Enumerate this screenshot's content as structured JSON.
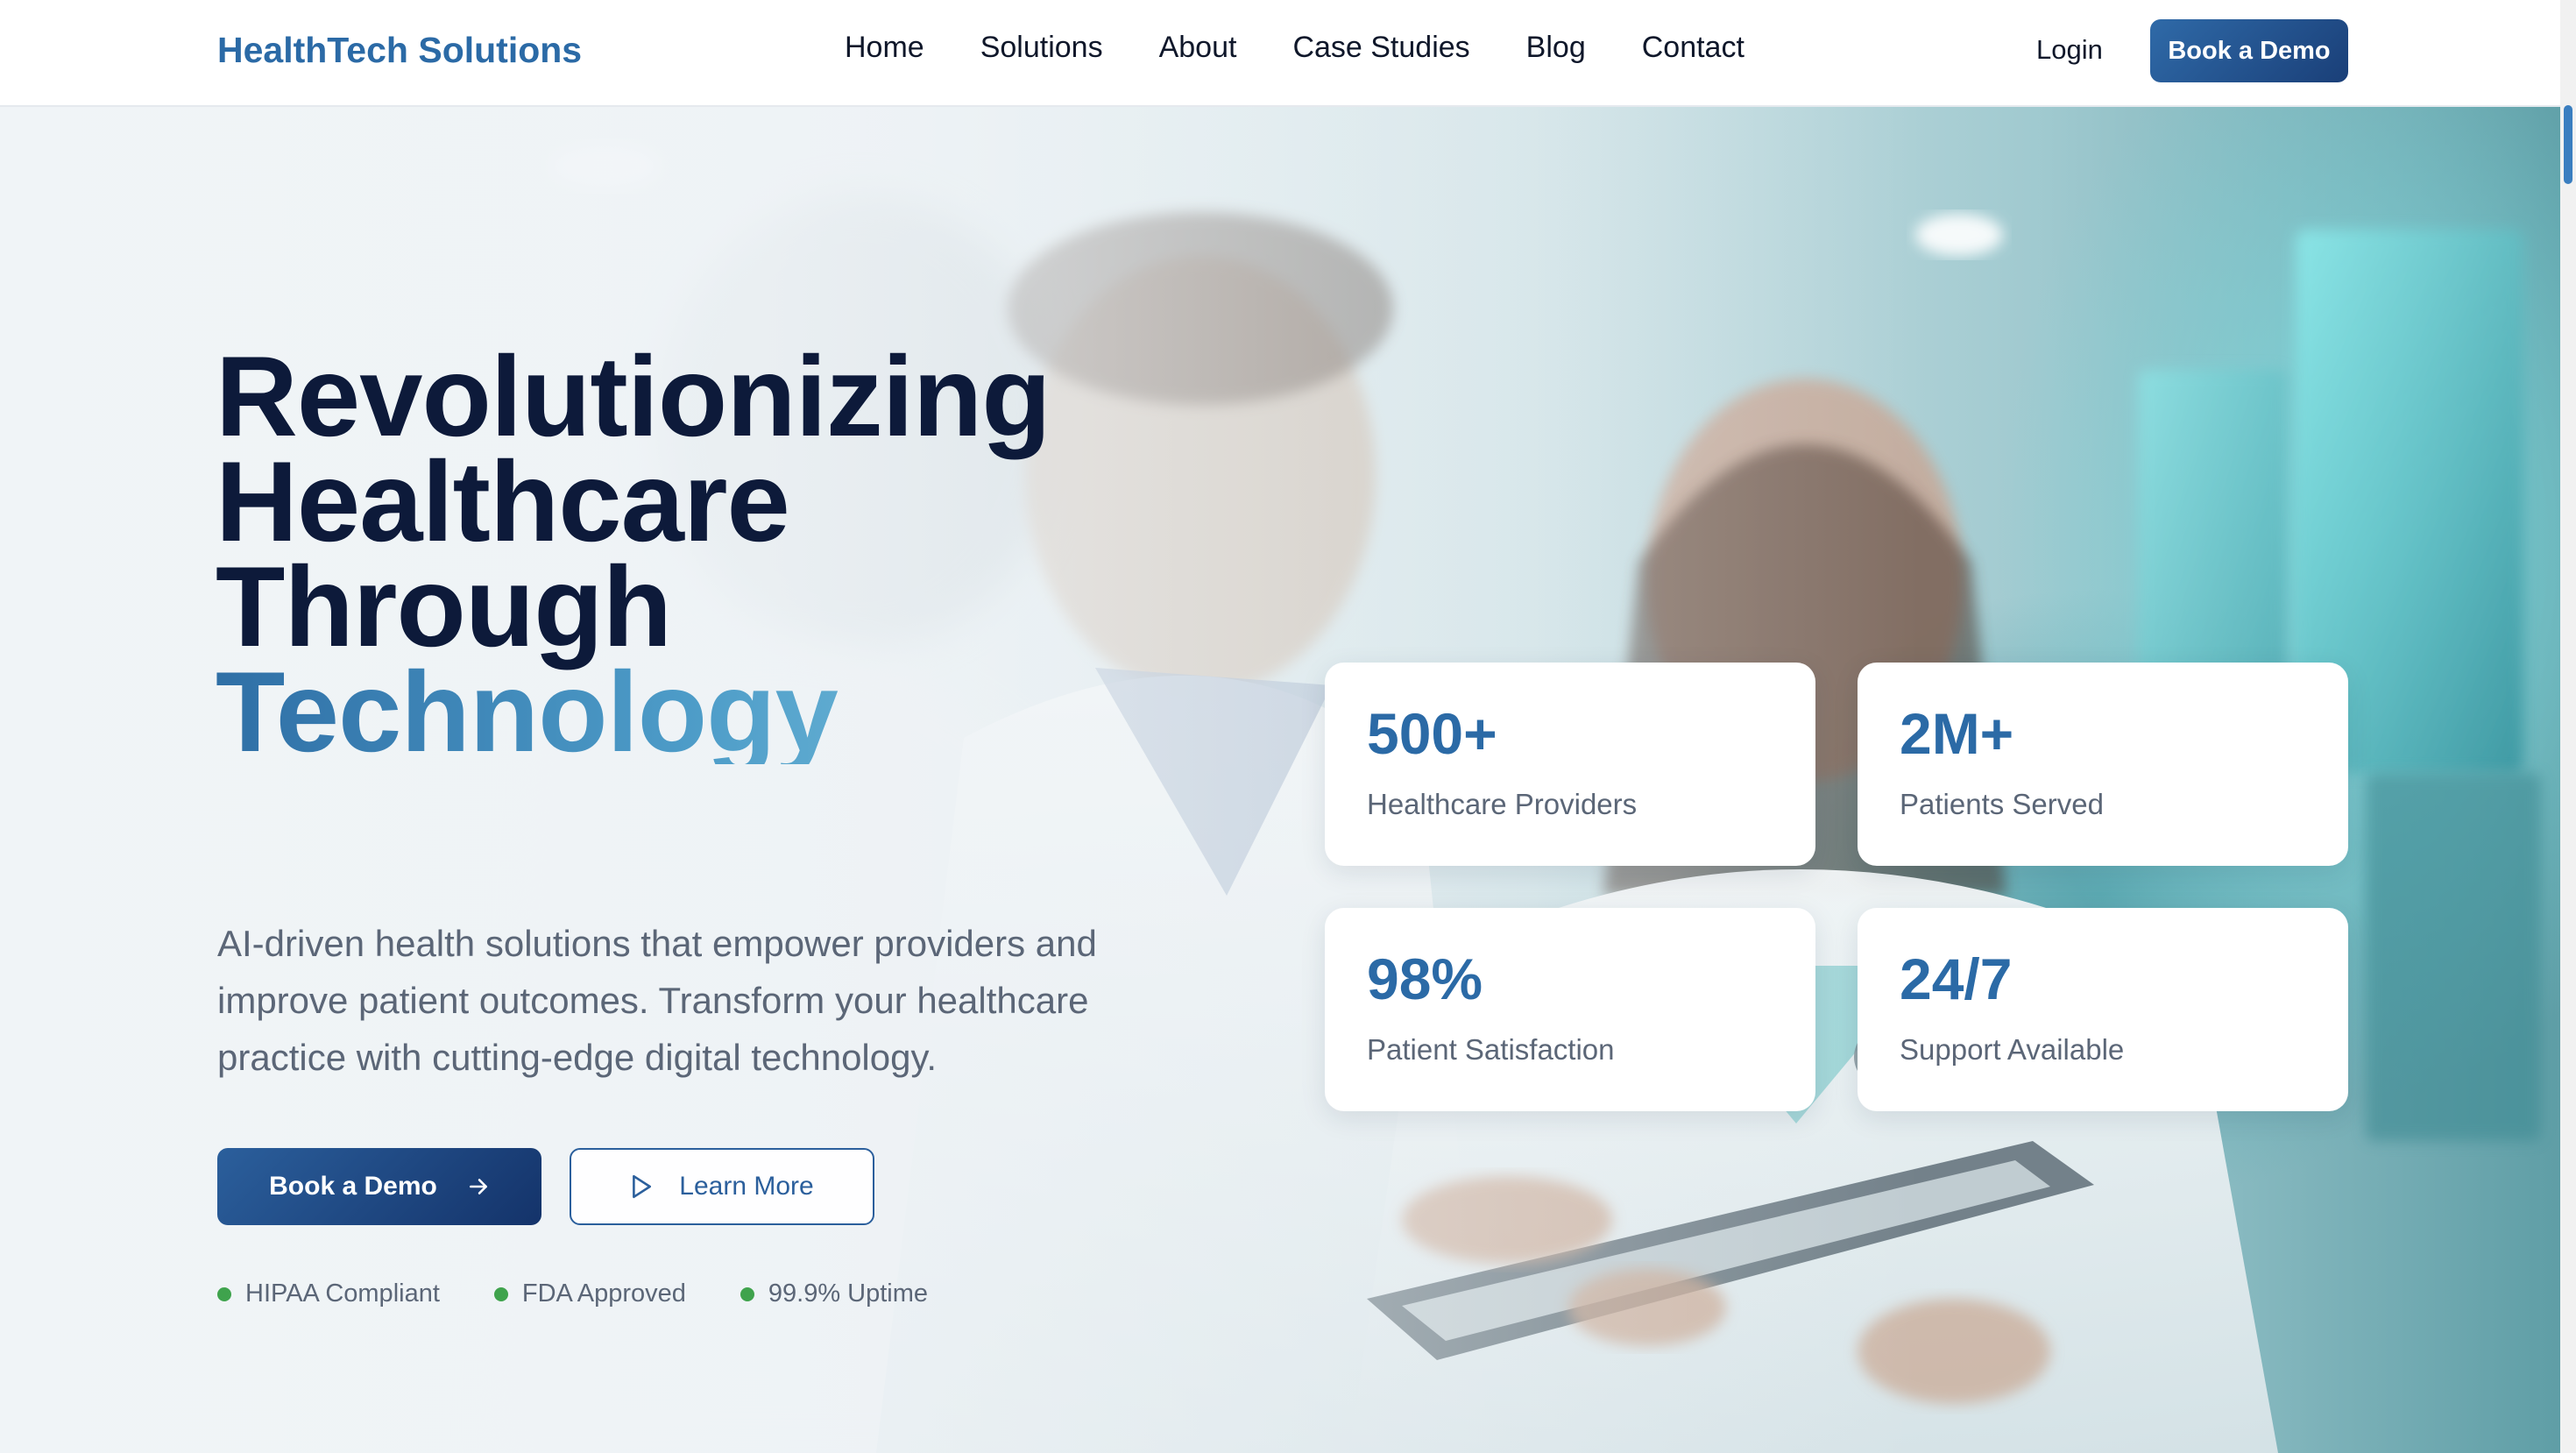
{
  "brand": {
    "name": "HealthTech Solutions"
  },
  "nav": {
    "items": [
      "Home",
      "Solutions",
      "About",
      "Case Studies",
      "Blog",
      "Contact"
    ]
  },
  "header": {
    "login_label": "Login",
    "demo_button_label": "Book a Demo"
  },
  "hero": {
    "headline_lines": [
      "Revolutionizing",
      "Healthcare",
      "Through",
      "Technology"
    ],
    "subtitle": "AI-driven health solutions that empower providers and improve patient outcomes. Transform your healthcare practice with cutting-edge digital technology.",
    "primary_button_label": "Book a Demo",
    "secondary_button_label": "Learn More",
    "badges": [
      "HIPAA Compliant",
      "FDA Approved",
      "99.9% Uptime"
    ]
  },
  "stats": [
    {
      "value": "500+",
      "label": "Healthcare Providers"
    },
    {
      "value": "2M+",
      "label": "Patients Served"
    },
    {
      "value": "98%",
      "label": "Patient Satisfaction"
    },
    {
      "value": "24/7",
      "label": "Support Available"
    }
  ],
  "colors": {
    "brand_blue": "#2b6aa6",
    "headline_navy": "#0d1a3a",
    "badge_green": "#3fa34d",
    "button_gradient_start": "#2b5f9c",
    "button_gradient_end": "#14336a"
  },
  "icons": {
    "primary_button": "arrow-right-icon",
    "secondary_button": "play-icon"
  }
}
